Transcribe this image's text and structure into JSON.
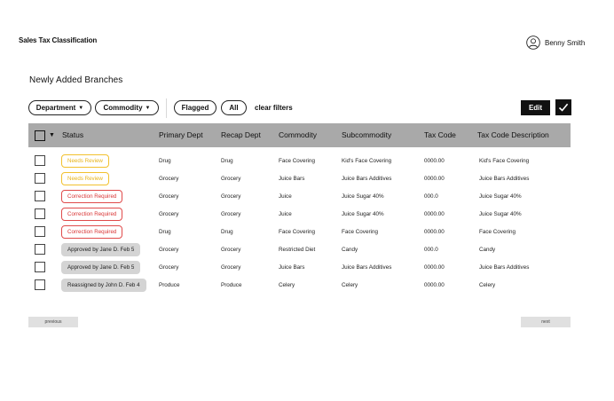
{
  "header": {
    "app_title": "Sales Tax Classification",
    "user_name": "Benny Smith",
    "user_icon": "user-circle-icon"
  },
  "section_title": "Newly Added Branches",
  "filters": {
    "department_label": "Department",
    "commodity_label": "Commodity",
    "flagged_label": "Flagged",
    "all_label": "All",
    "clear_label": "clear filters",
    "caret_icon": "caret-down-icon"
  },
  "actions": {
    "edit_label": "Edit",
    "confirm_icon": "checkmark-icon"
  },
  "table": {
    "columns": [
      "Status",
      "Primary Dept",
      "Recap Dept",
      "Commodity",
      "Subcommodity",
      "Tax Code",
      "Tax Code Description"
    ],
    "rows": [
      {
        "status": "Needs Review",
        "status_type": "review",
        "primary": "Drug",
        "recap": "Drug",
        "commodity": "Face Covering",
        "sub": "Kid's Face Covering",
        "tax": "0000.00",
        "desc": "Kid's Face Covering"
      },
      {
        "status": "Needs Review",
        "status_type": "review",
        "primary": "Grocery",
        "recap": "Grocery",
        "commodity": "Juice Bars",
        "sub": "Juice Bars Additives",
        "tax": "0000.00",
        "desc": "Juice Bars Additives"
      },
      {
        "status": "Correction Required",
        "status_type": "correction",
        "primary": "Grocery",
        "recap": "Grocery",
        "commodity": "Juice",
        "sub": "Juice Sugar 40%",
        "tax": "000.0",
        "desc": "Juice Sugar 40%"
      },
      {
        "status": "Correction Required",
        "status_type": "correction",
        "primary": "Grocery",
        "recap": "Grocery",
        "commodity": "Juice",
        "sub": "Juice Sugar 40%",
        "tax": "0000.00",
        "desc": "Juice Sugar 40%"
      },
      {
        "status": "Correction Required",
        "status_type": "correction",
        "primary": "Drug",
        "recap": "Drug",
        "commodity": "Face Covering",
        "sub": "Face Covering",
        "tax": "0000.00",
        "desc": "Face Covering"
      },
      {
        "status": "Approved by Jane D. Feb 5",
        "status_type": "approved",
        "primary": "Grocery",
        "recap": "Grocery",
        "commodity": "Restricted Diet",
        "sub": "Candy",
        "tax": "000.0",
        "desc": "Candy"
      },
      {
        "status": "Approved by Jane D. Feb 5",
        "status_type": "approved",
        "primary": "Grocery",
        "recap": "Grocery",
        "commodity": "Juice Bars",
        "sub": "Juice Bars Additives",
        "tax": "0000.00",
        "desc": "Juice Bars Additives"
      },
      {
        "status": "Reassigned by John D. Feb 4",
        "status_type": "approved",
        "primary": "Produce",
        "recap": "Produce",
        "commodity": "Celery",
        "sub": "Celery",
        "tax": "0000.00",
        "desc": "Celery"
      }
    ]
  },
  "pagination": {
    "previous_label": "previous",
    "next_label": "next"
  },
  "colors": {
    "header_bg": "#a9a9a9",
    "review": "#f2c12e",
    "correction": "#e04a4a",
    "approved_bg": "#d4d4d4"
  }
}
